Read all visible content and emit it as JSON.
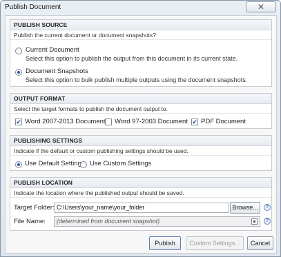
{
  "window": {
    "title": "Publish Document",
    "close_icon": "close-icon",
    "close_glyph": "✕"
  },
  "publish_source": {
    "header": "PUBLISH SOURCE",
    "description": "Publish the current document or document snapshots?",
    "options": [
      {
        "label": "Current Document",
        "description": "Select this option to publish the output from this document in its current state.",
        "selected": false
      },
      {
        "label": "Document Snapshots",
        "description": "Select this option to bulk publish multiple outputs using the document snapshots.",
        "selected": true
      }
    ]
  },
  "output_format": {
    "header": "OUTPUT FORMAT",
    "description": "Select the target formats to publish the document output to.",
    "formats": [
      {
        "label": "Word 2007-2013 Document",
        "checked": true
      },
      {
        "label": "Word 97-2003 Document",
        "checked": false
      },
      {
        "label": "PDF Document",
        "checked": true
      }
    ]
  },
  "publishing_settings": {
    "header": "PUBLISHING SETTINGS",
    "description": "Indicate if the default or custom publishing settings should be used.",
    "options": [
      {
        "label": "Use Default Settings",
        "selected": true
      },
      {
        "label": "Use Custom Settings",
        "selected": false
      }
    ]
  },
  "publish_location": {
    "header": "PUBLISH LOCATION",
    "description": "Indicate the location where the published output should be saved.",
    "target_folder_label": "Target Folder:",
    "target_folder_value": "C:\\Users\\your_name\\your_folder",
    "browse_label": "Browse...",
    "file_name_label": "File Name:",
    "file_name_value": "(determined from document snapshot)",
    "help_glyph": "?"
  },
  "footer": {
    "publish_label": "Publish",
    "custom_settings_label": "Custom Settings...",
    "cancel_label": "Cancel"
  },
  "check_glyph": "✔"
}
